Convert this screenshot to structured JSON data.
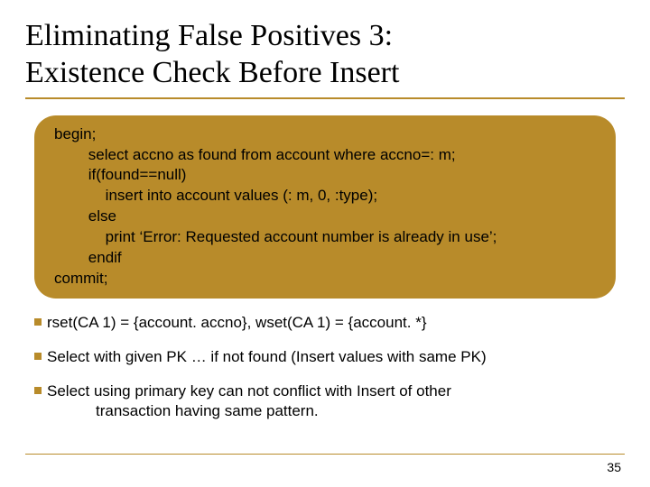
{
  "title_line1": "Eliminating False Positives 3:",
  "title_line2": "Existence Check Before Insert",
  "code": {
    "l0": "begin;",
    "l1": "        select accno as found from account where accno=: m;",
    "l2": "        if(found==null)",
    "l3": "            insert into account values (: m, 0, :type);",
    "l4": "        else",
    "l5": "            print ‘Error: Requested account number is already in use’;",
    "l6": "        endif",
    "l7": "commit;"
  },
  "bullets": {
    "b1": "rset(CA 1) = {account. accno}, wset(CA 1) = {account. *}",
    "b2": "Select with given PK … if not found (Insert values with same PK)",
    "b3_a": "Select using primary key can not conflict with Insert of other",
    "b3_b": "transaction having same pattern."
  },
  "page_number": "35"
}
